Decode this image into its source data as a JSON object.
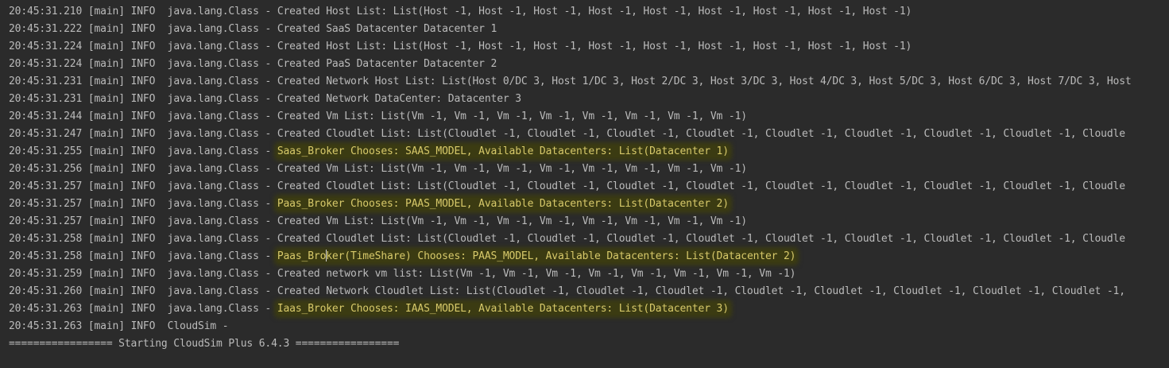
{
  "console": {
    "lines": [
      {
        "ts": "20:45:31.210",
        "thread": "[main]",
        "level": "INFO ",
        "logger": "java.lang.Class",
        "sep": " - ",
        "msg": "Created Host List: List(Host -1, Host -1, Host -1, Host -1, Host -1, Host -1, Host -1, Host -1, Host -1)",
        "highlight": false
      },
      {
        "ts": "20:45:31.222",
        "thread": "[main]",
        "level": "INFO ",
        "logger": "java.lang.Class",
        "sep": " - ",
        "msg": "Created SaaS Datacenter Datacenter 1",
        "highlight": false
      },
      {
        "ts": "20:45:31.224",
        "thread": "[main]",
        "level": "INFO ",
        "logger": "java.lang.Class",
        "sep": " - ",
        "msg": "Created Host List: List(Host -1, Host -1, Host -1, Host -1, Host -1, Host -1, Host -1, Host -1, Host -1)",
        "highlight": false
      },
      {
        "ts": "20:45:31.224",
        "thread": "[main]",
        "level": "INFO ",
        "logger": "java.lang.Class",
        "sep": " - ",
        "msg": "Created PaaS Datacenter Datacenter 2",
        "highlight": false
      },
      {
        "ts": "20:45:31.231",
        "thread": "[main]",
        "level": "INFO ",
        "logger": "java.lang.Class",
        "sep": " - ",
        "msg": "Created Network Host List: List(Host 0/DC 3, Host 1/DC 3, Host 2/DC 3, Host 3/DC 3, Host 4/DC 3, Host 5/DC 3, Host 6/DC 3, Host 7/DC 3, Host",
        "highlight": false
      },
      {
        "ts": "20:45:31.231",
        "thread": "[main]",
        "level": "INFO ",
        "logger": "java.lang.Class",
        "sep": " - ",
        "msg": "Created Network DataCenter: Datacenter 3",
        "highlight": false
      },
      {
        "ts": "20:45:31.244",
        "thread": "[main]",
        "level": "INFO ",
        "logger": "java.lang.Class",
        "sep": " - ",
        "msg": "Created Vm List: List(Vm -1, Vm -1, Vm -1, Vm -1, Vm -1, Vm -1, Vm -1, Vm -1)",
        "highlight": false
      },
      {
        "ts": "20:45:31.247",
        "thread": "[main]",
        "level": "INFO ",
        "logger": "java.lang.Class",
        "sep": " - ",
        "msg": "Created Cloudlet List: List(Cloudlet -1, Cloudlet -1, Cloudlet -1, Cloudlet -1, Cloudlet -1, Cloudlet -1, Cloudlet -1, Cloudlet -1, Cloudle",
        "highlight": false
      },
      {
        "ts": "20:45:31.255",
        "thread": "[main]",
        "level": "INFO ",
        "logger": "java.lang.Class",
        "sep": " - ",
        "msg": "Saas_Broker Chooses: SAAS_MODEL, Available Datacenters: List(Datacenter 1)",
        "highlight": true
      },
      {
        "ts": "20:45:31.256",
        "thread": "[main]",
        "level": "INFO ",
        "logger": "java.lang.Class",
        "sep": " - ",
        "msg": "Created Vm List: List(Vm -1, Vm -1, Vm -1, Vm -1, Vm -1, Vm -1, Vm -1, Vm -1)",
        "highlight": false
      },
      {
        "ts": "20:45:31.257",
        "thread": "[main]",
        "level": "INFO ",
        "logger": "java.lang.Class",
        "sep": " - ",
        "msg": "Created Cloudlet List: List(Cloudlet -1, Cloudlet -1, Cloudlet -1, Cloudlet -1, Cloudlet -1, Cloudlet -1, Cloudlet -1, Cloudlet -1, Cloudle",
        "highlight": false
      },
      {
        "ts": "20:45:31.257",
        "thread": "[main]",
        "level": "INFO ",
        "logger": "java.lang.Class",
        "sep": " - ",
        "msg": "Paas_Broker Chooses: PAAS_MODEL, Available Datacenters: List(Datacenter 2)",
        "highlight": true
      },
      {
        "ts": "20:45:31.257",
        "thread": "[main]",
        "level": "INFO ",
        "logger": "java.lang.Class",
        "sep": " - ",
        "msg": "Created Vm List: List(Vm -1, Vm -1, Vm -1, Vm -1, Vm -1, Vm -1, Vm -1, Vm -1)",
        "highlight": false
      },
      {
        "ts": "20:45:31.258",
        "thread": "[main]",
        "level": "INFO ",
        "logger": "java.lang.Class",
        "sep": " - ",
        "msg": "Created Cloudlet List: List(Cloudlet -1, Cloudlet -1, Cloudlet -1, Cloudlet -1, Cloudlet -1, Cloudlet -1, Cloudlet -1, Cloudlet -1, Cloudle",
        "highlight": false
      },
      {
        "ts": "20:45:31.258",
        "thread": "[main]",
        "level": "INFO ",
        "logger": "java.lang.Class",
        "sep": " - ",
        "msg": "Paas_Bro",
        "msg2": "ker(TimeShare) Chooses: PAAS_MODEL, Available Datacenters: List(Datacenter 2)",
        "highlight": true,
        "cursor": true
      },
      {
        "ts": "20:45:31.259",
        "thread": "[main]",
        "level": "INFO ",
        "logger": "java.lang.Class",
        "sep": " - ",
        "msg": "Created network vm list: List(Vm -1, Vm -1, Vm -1, Vm -1, Vm -1, Vm -1, Vm -1, Vm -1)",
        "highlight": false
      },
      {
        "ts": "20:45:31.260",
        "thread": "[main]",
        "level": "INFO ",
        "logger": "java.lang.Class",
        "sep": " - ",
        "msg": "Created Network Cloudlet List: List(Cloudlet -1, Cloudlet -1, Cloudlet -1, Cloudlet -1, Cloudlet -1, Cloudlet -1, Cloudlet -1, Cloudlet -1,",
        "highlight": false
      },
      {
        "ts": "20:45:31.263",
        "thread": "[main]",
        "level": "INFO ",
        "logger": "java.lang.Class",
        "sep": " - ",
        "msg": "Iaas_Broker Chooses: IAAS_MODEL, Available Datacenters: List(Datacenter 3)",
        "highlight": true
      },
      {
        "ts": "20:45:31.263",
        "thread": "[main]",
        "level": "INFO ",
        "logger": "CloudSim",
        "sep": " - ",
        "msg": "",
        "highlight": false
      },
      {
        "plain": "================= Starting CloudSim Plus 6.4.3 ================="
      }
    ]
  },
  "colors": {
    "background": "#2b2b2b",
    "text": "#bbbbbb",
    "highlight_text": "#d7c96a",
    "highlight_background": "#3b3b12"
  }
}
